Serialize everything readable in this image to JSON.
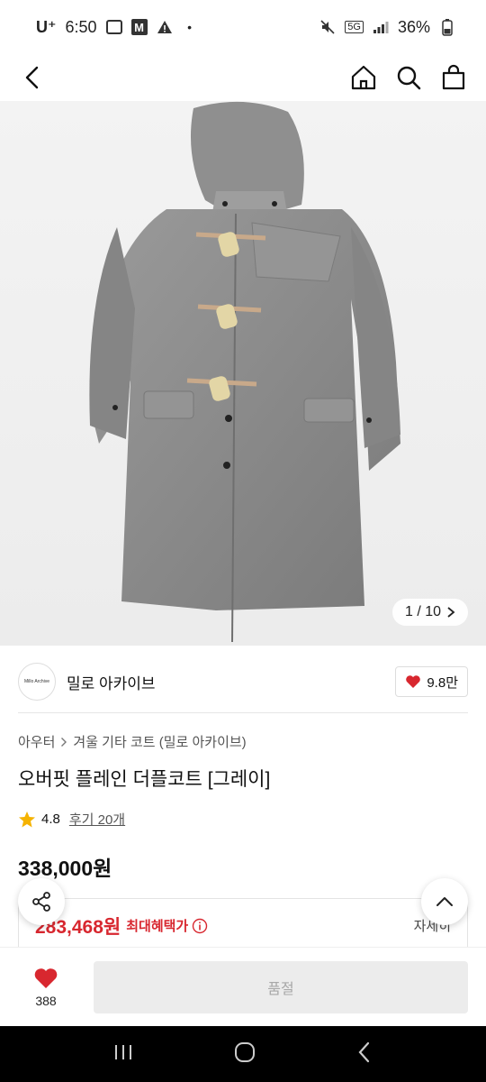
{
  "status_bar": {
    "carrier": "U⁺",
    "time": "6:50",
    "network": "5G",
    "battery": "36%"
  },
  "nav": {
    "icons": [
      "back-icon",
      "home-icon",
      "search-icon",
      "bag-icon"
    ]
  },
  "gallery": {
    "counter": "1 / 10"
  },
  "brand": {
    "logo_text": "Millo Archive",
    "name": "밀로 아카이브",
    "likes": "9.8만"
  },
  "product": {
    "breadcrumb": [
      "아우터",
      "겨울 기타 코트 (밀로 아카이브)"
    ],
    "title": "오버핏 플레인 더플코트 [그레이]",
    "rating": "4.8",
    "reviews": "후기 20개",
    "price": "338,000원"
  },
  "benefit": {
    "price": "283,468원",
    "label": "최대혜택가",
    "detail": "자세히"
  },
  "bottom": {
    "wish_count": "388",
    "soldout_label": "품절"
  },
  "colors": {
    "accent_red": "#d8272f",
    "star": "#f5b301"
  }
}
